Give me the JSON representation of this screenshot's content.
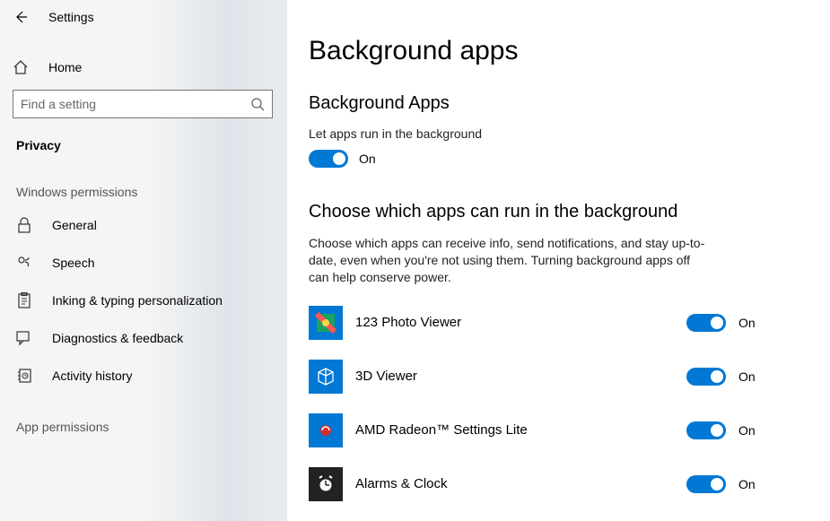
{
  "header": {
    "settings_label": "Settings",
    "home_label": "Home"
  },
  "search": {
    "placeholder": "Find a setting"
  },
  "sidebar": {
    "page_section": "Privacy",
    "group1_label": "Windows permissions",
    "items1": [
      {
        "label": "General"
      },
      {
        "label": "Speech"
      },
      {
        "label": "Inking & typing personalization"
      },
      {
        "label": "Diagnostics & feedback"
      },
      {
        "label": "Activity history"
      }
    ],
    "group2_label": "App permissions"
  },
  "main": {
    "title": "Background apps",
    "section1_title": "Background Apps",
    "let_apps_run_label": "Let apps run in the background",
    "master_toggle_state": "On",
    "section2_title": "Choose which apps can run in the background",
    "section2_desc": "Choose which apps can receive info, send notifications, and stay up-to-date, even when you're not using them. Turning background apps off can help conserve power.",
    "apps": [
      {
        "name": "123 Photo Viewer",
        "state": "On"
      },
      {
        "name": "3D Viewer",
        "state": "On"
      },
      {
        "name": "AMD Radeon™ Settings Lite",
        "state": "On"
      },
      {
        "name": "Alarms & Clock",
        "state": "On"
      }
    ]
  }
}
